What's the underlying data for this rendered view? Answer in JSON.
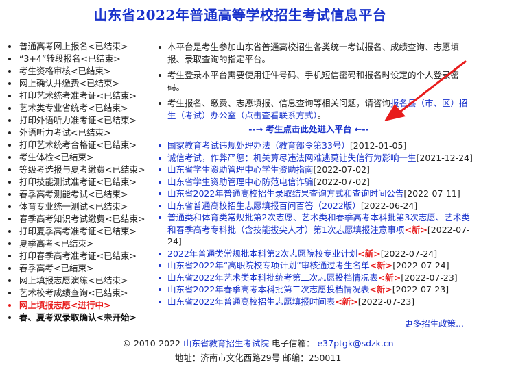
{
  "header": {
    "title": "山东省2022年普通高等学校招生考试信息平台"
  },
  "sidebar": {
    "items": [
      {
        "label": "普通高考网上报名<已结束>",
        "status": "done"
      },
      {
        "label": "“3+4”转段报名<已结束>",
        "status": "done"
      },
      {
        "label": "考生资格审核<已结束>",
        "status": "done"
      },
      {
        "label": "网上确认并缴费<已结束>",
        "status": "done"
      },
      {
        "label": "打印艺术统考准考证<已结束>",
        "status": "done"
      },
      {
        "label": "艺术类专业省统考<已结束>",
        "status": "done"
      },
      {
        "label": "打印外语听力准考证<已结束>",
        "status": "done"
      },
      {
        "label": "外语听力考试<已结束>",
        "status": "done"
      },
      {
        "label": "打印艺术统考合格证<已结束>",
        "status": "done"
      },
      {
        "label": "考生体检<已结束>",
        "status": "done"
      },
      {
        "label": "等级考选报与夏考缴费<已结束>",
        "status": "done"
      },
      {
        "label": "打印技能测试准考证<已结束>",
        "status": "done"
      },
      {
        "label": "春季高考测能考试<已结束>",
        "status": "done"
      },
      {
        "label": "体育专业统一测试<已结束>",
        "status": "done"
      },
      {
        "label": "春季高考知识考试缴费<已结束>",
        "status": "done"
      },
      {
        "label": "打印夏季高考准考证<已结束>",
        "status": "done"
      },
      {
        "label": "夏季高考<已结束>",
        "status": "done"
      },
      {
        "label": "打印春季高考准考证<已结束>",
        "status": "done"
      },
      {
        "label": "春季高考<已结束>",
        "status": "done"
      },
      {
        "label": "网上填报志愿演练<已结束>",
        "status": "done"
      },
      {
        "label": "艺术校考成绩查询<已结束>",
        "status": "done"
      },
      {
        "label": "网上填报志愿<进行中>",
        "status": "ongoing"
      },
      {
        "label": "春、夏考双录取确认<未开始>",
        "status": "upcoming"
      }
    ]
  },
  "notices": {
    "n1": "本平台是考生参加山东省普通高校招生各类统一考试报名、成绩查询、志愿填报、录取查询的指定平台。",
    "n2": "考生登录本平台需要使用证件号码、手机短信密码和报名时设定的个人登录密码。",
    "n3_prefix": "考生报名、缴费、志愿填报、信息查询等相关问题，请咨询",
    "n3_link": "报名县（市、区）招生（考试）办公室（点击查看联系方式）",
    "n3_suffix": "。"
  },
  "enter_link": "--→ 考生点击此处进入平台 ←--",
  "news": [
    {
      "title": "国家教育考试违规处理办法（教育部令第33号）",
      "date": "[2012-01-05]",
      "is_new": false
    },
    {
      "title": "诚信考试，作弊严惩：机关算尽违法网难逃莫让失信行为影响一生",
      "date": "[2021-12-24]",
      "is_new": false
    },
    {
      "title": "山东省学生资助管理中心学生资助指南",
      "date": "[2022-07-02]",
      "is_new": false
    },
    {
      "title": "山东省学生资助管理中心防范电信诈骗",
      "date": "[2022-07-02]",
      "is_new": false
    },
    {
      "title": "山东省2022年普通高校招生录取结果查询方式和查询时间公告",
      "date": "[2022-07-11]",
      "is_new": false
    },
    {
      "title": "山东省普通高校招生志愿填报百问百答（2022版）",
      "date": "[2022-06-24]",
      "is_new": false
    },
    {
      "title": "普通类和体育类常规批第2次志愿、艺术类和春季高考本科批第3次志愿、艺术类和春季高考专科批（含技能拔尖人才）第1次志愿填报注意事项",
      "date": "[2022-07-24]",
      "is_new": true
    },
    {
      "title": "2022年普通类常规批本科第2次志愿院校专业计划",
      "date": "[2022-07-24]",
      "is_new": true
    },
    {
      "title": "山东省2022年“高职院校专项计划”审核通过考生名单",
      "date": "[2022-07-24]",
      "is_new": true
    },
    {
      "title": "山东省2022年艺术类本科批统考第二次志愿投档情况表",
      "date": "[2022-07-23]",
      "is_new": true
    },
    {
      "title": "山东省2022年春季高考本科批第二次志愿投档情况表",
      "date": "[2022-07-23]",
      "is_new": true
    },
    {
      "title": "山东省2022年普通高校招生志愿填报时间表",
      "date": "[2022-07-23]",
      "is_new": true
    }
  ],
  "new_badge": "<新>",
  "more_link": "更多招生政策...",
  "footer": {
    "copyright": "© 2010-2022",
    "org_link": "山东省教育招生考试院",
    "email_label": "电子信箱：",
    "email": "e37ptgk@sdzk.cn",
    "address": "地址：济南市文化西路29号 邮编：250011"
  },
  "colors": {
    "link_blue": "#1a33cc",
    "alert_red": "#e81c1c",
    "annotation_arrow": "#e81c1c"
  },
  "annotation": {
    "icon": "red-arrow-icon"
  }
}
